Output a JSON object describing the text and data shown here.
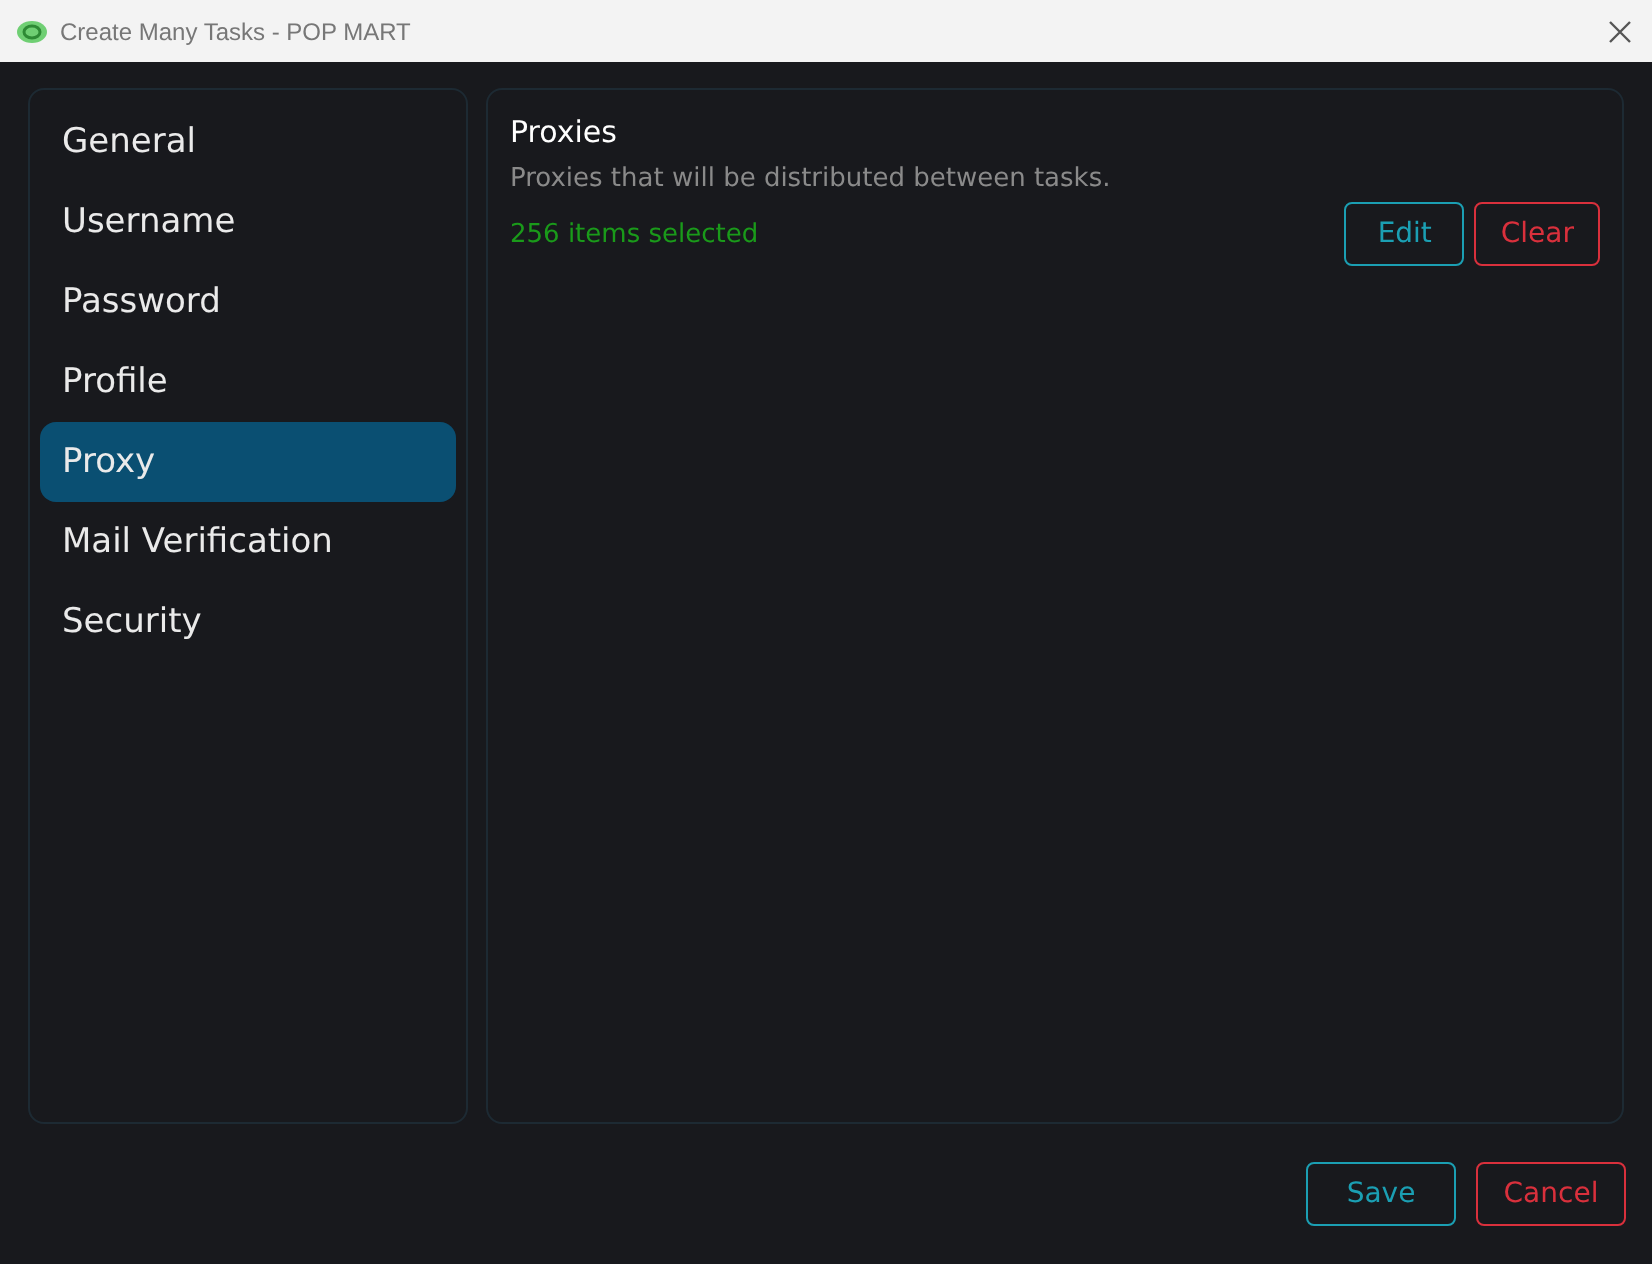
{
  "window": {
    "title": "Create Many Tasks - POP MART"
  },
  "sidebar": {
    "items": [
      {
        "label": "General",
        "selected": false
      },
      {
        "label": "Username",
        "selected": false
      },
      {
        "label": "Password",
        "selected": false
      },
      {
        "label": "Profile",
        "selected": false
      },
      {
        "label": "Proxy",
        "selected": true
      },
      {
        "label": "Mail Verification",
        "selected": false
      },
      {
        "label": "Security",
        "selected": false
      }
    ]
  },
  "section": {
    "title": "Proxies",
    "description": "Proxies that will be distributed between tasks.",
    "status": "256 items selected",
    "buttons": [
      {
        "label": "Edit",
        "kind": "primary"
      },
      {
        "label": "Clear",
        "kind": "danger"
      }
    ]
  },
  "footer": {
    "buttons": [
      {
        "label": "Save",
        "kind": "primary"
      },
      {
        "label": "Cancel",
        "kind": "danger"
      }
    ]
  }
}
